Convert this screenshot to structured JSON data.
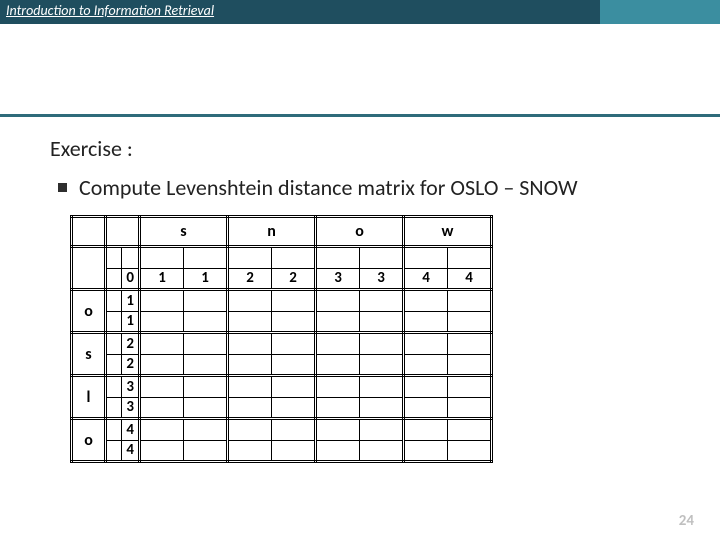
{
  "header": {
    "title": "Introduction to Information Retrieval"
  },
  "exercise": {
    "label": "Exercise :",
    "bullet_text": "Compute Levenshtein distance matrix for OSLO – SNOW"
  },
  "matrix": {
    "col_headers": [
      "s",
      "n",
      "o",
      "w"
    ],
    "row_headers": [
      "o",
      "s",
      "l",
      "o"
    ],
    "first_row": {
      "lead": {
        "tl": "",
        "tr": "",
        "bl": "",
        "br": "0"
      },
      "cells": [
        {
          "tl": "",
          "tr": "",
          "bl": "1",
          "br": "1"
        },
        {
          "tl": "",
          "tr": "",
          "bl": "2",
          "br": "2"
        },
        {
          "tl": "",
          "tr": "",
          "bl": "3",
          "br": "3"
        },
        {
          "tl": "",
          "tr": "",
          "bl": "4",
          "br": "4"
        }
      ]
    },
    "body_rows": [
      {
        "lead": {
          "tl": "",
          "tr": "1",
          "bl": "",
          "br": "1"
        },
        "cells": [
          {},
          {},
          {},
          {}
        ]
      },
      {
        "lead": {
          "tl": "",
          "tr": "2",
          "bl": "",
          "br": "2"
        },
        "cells": [
          {},
          {},
          {},
          {}
        ]
      },
      {
        "lead": {
          "tl": "",
          "tr": "3",
          "bl": "",
          "br": "3"
        },
        "cells": [
          {},
          {},
          {},
          {}
        ]
      },
      {
        "lead": {
          "tl": "",
          "tr": "4",
          "bl": "",
          "br": "4"
        },
        "cells": [
          {},
          {},
          {},
          {}
        ]
      }
    ]
  },
  "page_number": "24"
}
